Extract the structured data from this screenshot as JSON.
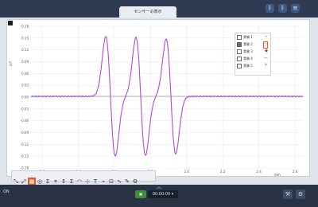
{
  "window": {
    "title": "センサーの表示"
  },
  "plot": {
    "y_unit": "mT",
    "x_unit": "mm",
    "y_ticks": [
      "0.18",
      "0.15",
      "0.12",
      "0.09",
      "0.06",
      "0.03",
      "0.00",
      "-0.03",
      "-0.06",
      "-0.09",
      "-0.12",
      "-0.15",
      "-0.18"
    ],
    "x_ticks": [
      "1.2",
      "1.4",
      "1.6",
      "1.8",
      "2.0",
      "2.2",
      "2.4",
      "2.6"
    ],
    "line_color": "#b04bd6",
    "baseline_color": "#6a6a6a"
  },
  "legend": {
    "items": [
      {
        "label": "実験 1",
        "checked": false,
        "marker": "+"
      },
      {
        "label": "実験 2",
        "checked": true,
        "marker": "○"
      },
      {
        "label": "実験 3",
        "checked": false,
        "marker": "◆"
      },
      {
        "label": "実験 4",
        "checked": false,
        "marker": "—"
      },
      {
        "label": "実験 5",
        "checked": false,
        "marker": "＊"
      }
    ]
  },
  "toolbar": {
    "tools": [
      "⤡",
      "⤢",
      "▦",
      "◎",
      "Σ",
      "⌗",
      "↕",
      "Σ",
      "◠",
      "⊹",
      "T",
      "⌁",
      "⊡",
      "∿",
      "✎",
      "⚙"
    ]
  },
  "bottom": {
    "left_label": "ON",
    "run_label": "■",
    "time": "00:00:00 ▾",
    "chevron": "︿"
  }
}
